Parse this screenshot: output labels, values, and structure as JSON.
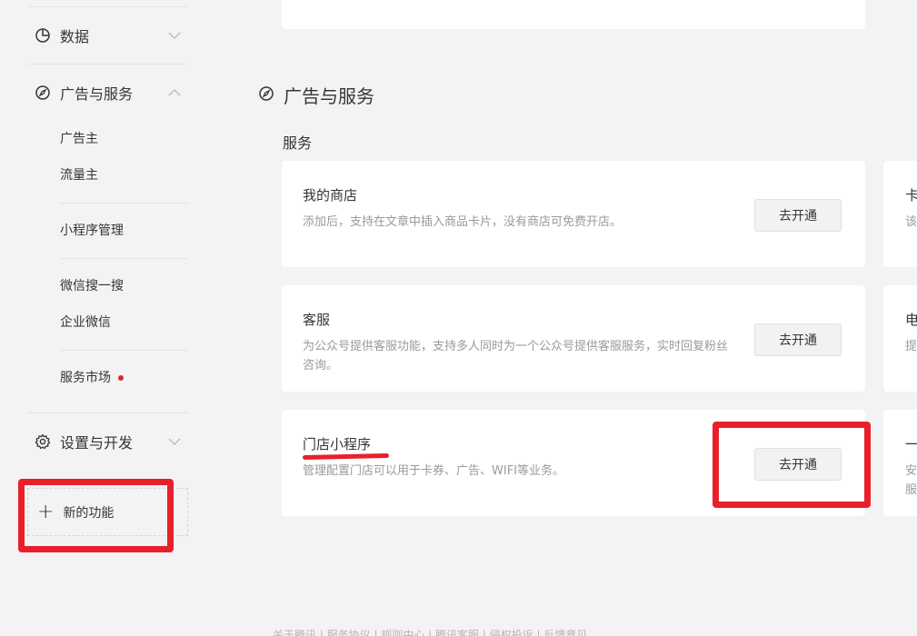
{
  "sidebar": {
    "sections": [
      {
        "label": "数据",
        "icon": "pie-chart-icon"
      },
      {
        "label": "广告与服务",
        "icon": "compass-icon"
      },
      {
        "label": "设置与开发",
        "icon": "gear-icon"
      }
    ],
    "items": {
      "advertiser": "广告主",
      "publisher": "流量主",
      "mini_program_mgmt": "小程序管理",
      "wechat_search": "微信搜一搜",
      "wecom": "企业微信",
      "service_market": "服务市场"
    },
    "new_feature": "新的功能"
  },
  "main": {
    "section_title": "广告与服务",
    "subsection_title": "服务",
    "cards": [
      {
        "title": "我的商店",
        "desc": "添加后，支持在文章中插入商品卡片，没有商店可免费开店。",
        "button": "去开通"
      },
      {
        "title": "客服",
        "desc": "为公众号提供客服功能，支持多人同时为一个公众号提供客服服务，实时回复粉丝咨询。",
        "button": "去开通"
      },
      {
        "title": "门店小程序",
        "desc": "管理配置门店可以用于卡券、广告、WIFI等业务。",
        "button": "去开通"
      }
    ],
    "side_cards": [
      {
        "title": "卡",
        "desc": "该"
      },
      {
        "title": "电",
        "desc": "提"
      },
      {
        "title": "一",
        "desc1": "安",
        "desc2": "服"
      }
    ]
  },
  "footer": "关于腾讯 | 服务协议 | 规则中心 | 腾讯客服 | 侵权投诉 | 反馈意见"
}
